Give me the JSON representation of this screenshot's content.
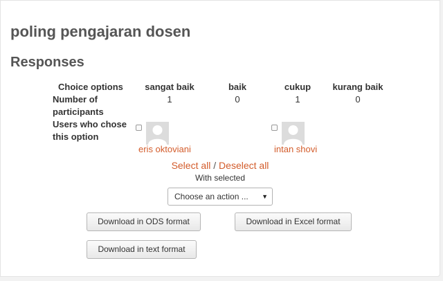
{
  "page": {
    "title": "poling pengajaran dosen",
    "subtitle": "Responses"
  },
  "table": {
    "header_label": "Choice options",
    "options": [
      "sangat baik",
      "baik",
      "cukup",
      "kurang baik"
    ],
    "participants_label": "Number of participants",
    "participants_label_line1": "Number of",
    "participants_label_line2": "participants",
    "counts": [
      1,
      0,
      1,
      0
    ],
    "users_label_line1": "Users who chose",
    "users_label_line2": "this option",
    "users": [
      {
        "option": "sangat baik",
        "name": "eris oktoviani",
        "checked": false
      },
      {
        "option": "cukup",
        "name": "intan shovi",
        "checked": false
      }
    ]
  },
  "selection": {
    "select_all": "Select all",
    "separator": "/",
    "deselect_all": "Deselect all",
    "with_selected": "With selected",
    "action_placeholder": "Choose an action ...",
    "arrow_glyph": "▼"
  },
  "buttons": {
    "download_ods": "Download in ODS format",
    "download_excel": "Download in Excel format",
    "download_text": "Download in text format"
  },
  "colors": {
    "link": "#d35c2b",
    "heading": "#555555"
  }
}
